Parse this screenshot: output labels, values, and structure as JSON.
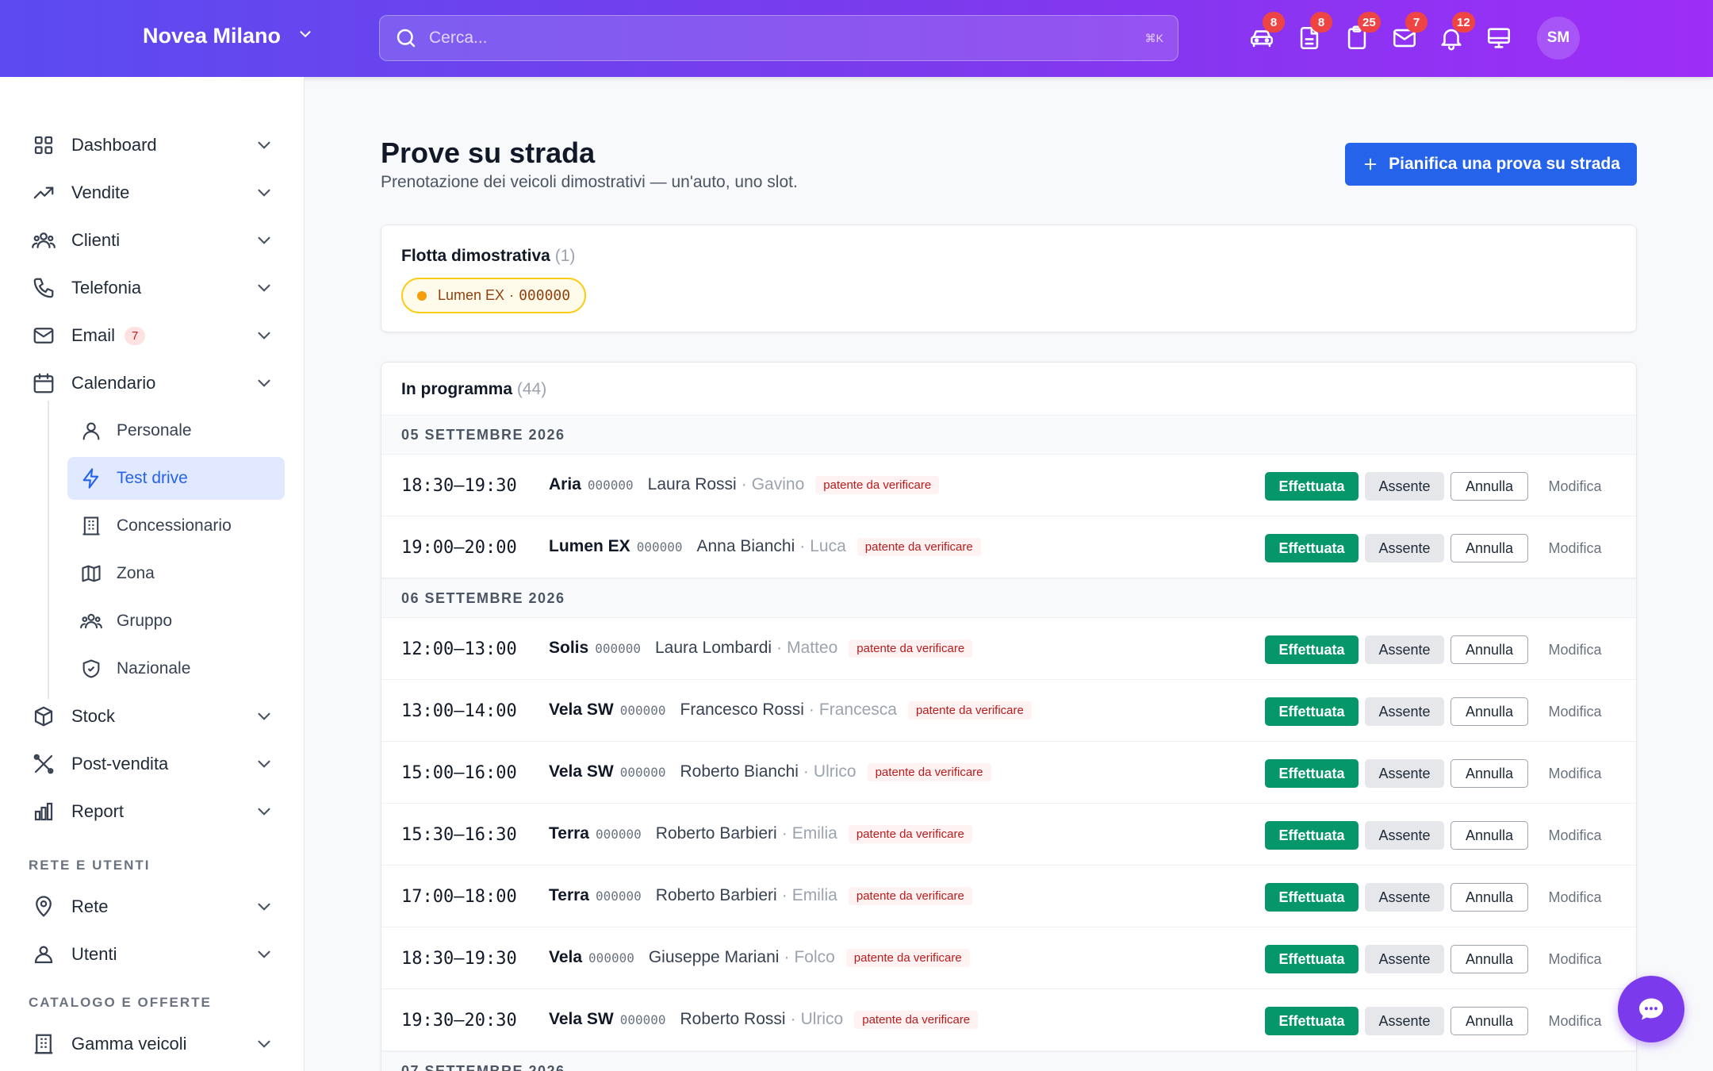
{
  "header": {
    "brand": "Novea Milano",
    "search_placeholder": "Cerca...",
    "search_shortcut": "⌘K",
    "icons": [
      {
        "name": "car-icon",
        "badge": "8"
      },
      {
        "name": "document-icon",
        "badge": "8"
      },
      {
        "name": "clipboard-icon",
        "badge": "25"
      },
      {
        "name": "mail-icon",
        "badge": "7"
      },
      {
        "name": "bell-icon",
        "badge": "12"
      },
      {
        "name": "monitor-icon",
        "badge": ""
      }
    ],
    "avatar": "SM"
  },
  "sidebar": {
    "items": [
      {
        "label": "Dashboard",
        "icon": "grid-icon"
      },
      {
        "label": "Vendite",
        "icon": "trending-icon"
      },
      {
        "label": "Clienti",
        "icon": "users-icon"
      },
      {
        "label": "Telefonia",
        "icon": "phone-icon"
      },
      {
        "label": "Email",
        "icon": "mail-icon",
        "badge": "7"
      },
      {
        "label": "Calendario",
        "icon": "calendar-icon"
      }
    ],
    "sub_items": [
      {
        "label": "Personale",
        "icon": "user-icon"
      },
      {
        "label": "Test drive",
        "icon": "bolt-icon",
        "active": true
      },
      {
        "label": "Concessionario",
        "icon": "building-icon"
      },
      {
        "label": "Zona",
        "icon": "map-icon"
      },
      {
        "label": "Gruppo",
        "icon": "group-icon"
      },
      {
        "label": "Nazionale",
        "icon": "shield-icon"
      }
    ],
    "items_after": [
      {
        "label": "Stock",
        "icon": "box-icon"
      },
      {
        "label": "Post-vendita",
        "icon": "tools-icon"
      },
      {
        "label": "Report",
        "icon": "chart-icon"
      }
    ],
    "section_network": "RETE E UTENTI",
    "network_items": [
      {
        "label": "Rete",
        "icon": "pin-icon"
      },
      {
        "label": "Utenti",
        "icon": "user-cog-icon"
      }
    ],
    "section_catalog": "CATALOGO E OFFERTE",
    "catalog_items": [
      {
        "label": "Gamma veicoli",
        "icon": "building-icon"
      }
    ]
  },
  "main": {
    "title": "Prove su strada",
    "subtitle": "Prenotazione dei veicoli dimostrativi — un'auto, uno slot.",
    "primary_button": "Pianifica una prova su strada",
    "fleet": {
      "title": "Flotta dimostrativa",
      "count": "(1)",
      "chip_model": "Lumen EX",
      "chip_sep": "·",
      "chip_plate": "000000"
    },
    "schedule": {
      "title": "In programma",
      "count": "(44)",
      "labels": {
        "done": "Effettuata",
        "absent": "Assente",
        "cancel": "Annulla",
        "edit": "Modifica",
        "warning": "patente da verificare",
        "sep": "·"
      },
      "groups": [
        {
          "date": "05 SETTEMBRE 2026",
          "rows": [
            {
              "time": "18:30–19:30",
              "model": "Aria",
              "plate": "000000",
              "customer": "Laura Rossi",
              "seller": "Gavino"
            },
            {
              "time": "19:00–20:00",
              "model": "Lumen EX",
              "plate": "000000",
              "customer": "Anna Bianchi",
              "seller": "Luca"
            }
          ]
        },
        {
          "date": "06 SETTEMBRE 2026",
          "rows": [
            {
              "time": "12:00–13:00",
              "model": "Solis",
              "plate": "000000",
              "customer": "Laura Lombardi",
              "seller": "Matteo"
            },
            {
              "time": "13:00–14:00",
              "model": "Vela SW",
              "plate": "000000",
              "customer": "Francesco Rossi",
              "seller": "Francesca"
            },
            {
              "time": "15:00–16:00",
              "model": "Vela SW",
              "plate": "000000",
              "customer": "Roberto Bianchi",
              "seller": "Ulrico"
            },
            {
              "time": "15:30–16:30",
              "model": "Terra",
              "plate": "000000",
              "customer": "Roberto Barbieri",
              "seller": "Emilia"
            },
            {
              "time": "17:00–18:00",
              "model": "Terra",
              "plate": "000000",
              "customer": "Roberto Barbieri",
              "seller": "Emilia"
            },
            {
              "time": "18:30–19:30",
              "model": "Vela",
              "plate": "000000",
              "customer": "Giuseppe Mariani",
              "seller": "Folco"
            },
            {
              "time": "19:30–20:30",
              "model": "Vela SW",
              "plate": "000000",
              "customer": "Roberto Rossi",
              "seller": "Ulrico"
            }
          ]
        },
        {
          "date": "07 SETTEMBRE 2026",
          "rows": []
        }
      ]
    }
  },
  "colors": {
    "header_from": "#5b4bf0",
    "header_to": "#9d2df7",
    "primary": "#2563eb",
    "success": "#059669",
    "badge": "#ef4444",
    "fab": "#7c3aed"
  }
}
